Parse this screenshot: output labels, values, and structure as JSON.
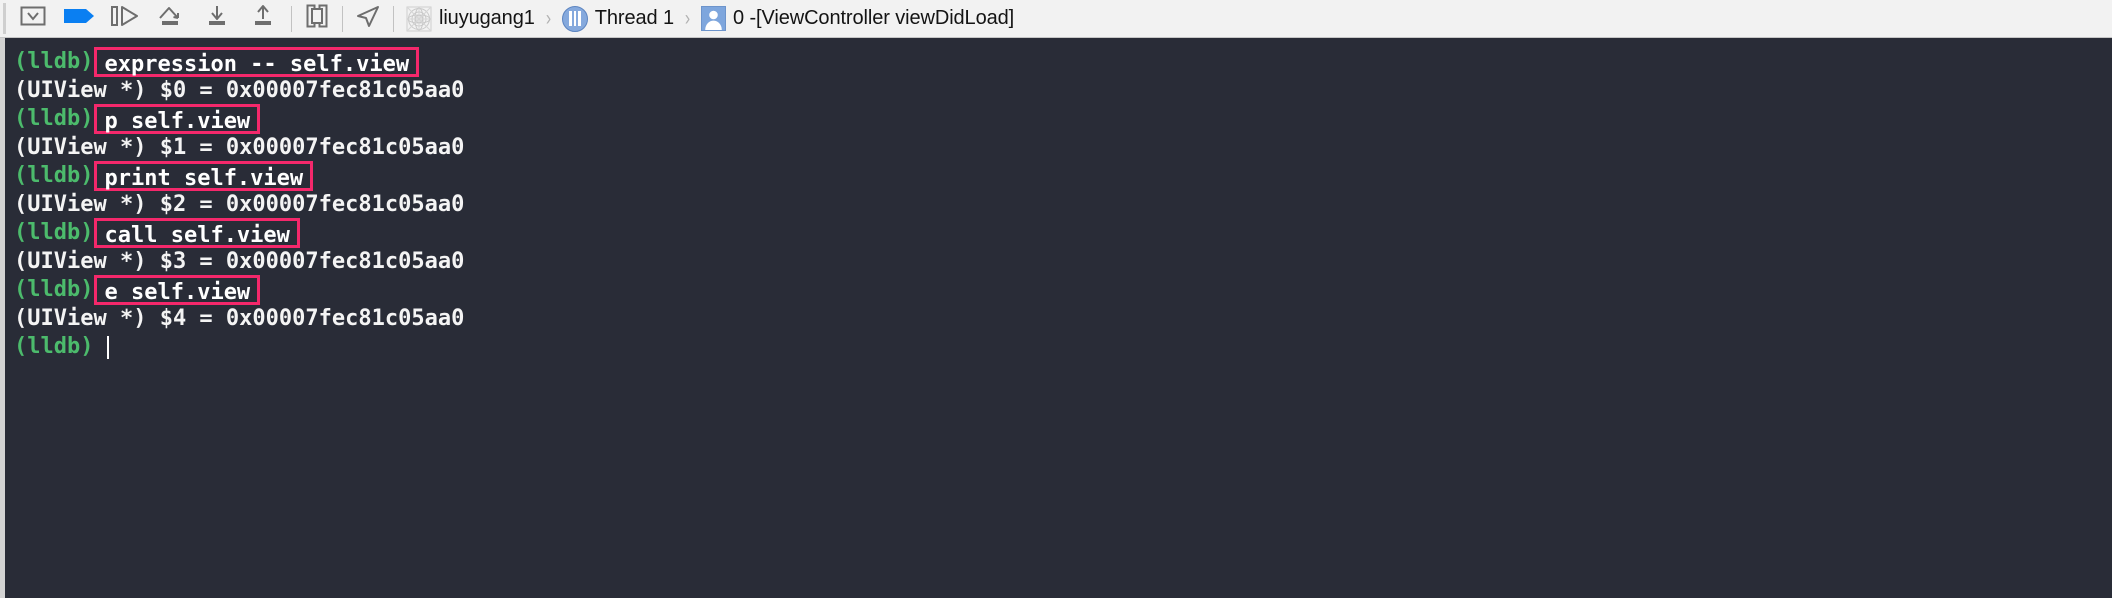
{
  "toolbar": {
    "buttons": [
      {
        "name": "hide-console-button",
        "icon": "panel-chevron-down-icon",
        "label": "Hide Console"
      },
      {
        "name": "deactivate-breakpoints-button",
        "icon": "breakpoint-flag-icon",
        "label": "Deactivate Breakpoints"
      },
      {
        "name": "continue-button",
        "icon": "pause-play-icon",
        "label": "Continue program execution"
      },
      {
        "name": "step-over-button",
        "icon": "step-over-icon",
        "label": "Step over"
      },
      {
        "name": "step-into-button",
        "icon": "step-into-icon",
        "label": "Step into"
      },
      {
        "name": "step-out-button",
        "icon": "step-out-icon",
        "label": "Step out"
      },
      {
        "name": "debug-view-hierarchy-button",
        "icon": "view-hierarchy-icon",
        "label": "Debug View Hierarchy"
      },
      {
        "name": "simulate-location-button",
        "icon": "location-arrow-icon",
        "label": "Simulate Location"
      }
    ]
  },
  "breadcrumb": {
    "process": {
      "label": "liuyugang1",
      "icon": "process-mesh-icon"
    },
    "thread": {
      "label": "Thread 1",
      "icon": "thread-icon"
    },
    "frame": {
      "label": "0 -[ViewController viewDidLoad]",
      "icon": "stack-frame-icon"
    },
    "separator": "›"
  },
  "console": {
    "prompt": "(lldb)",
    "result_address": "0x00007fec81c05aa0",
    "caret_visible": true,
    "lines": [
      {
        "type": "command",
        "prompt": "(lldb)",
        "command": "expression -- self.view",
        "highlighted": true
      },
      {
        "type": "output",
        "text": "(UIView *) $0 = 0x00007fec81c05aa0"
      },
      {
        "type": "command",
        "prompt": "(lldb)",
        "command": "p self.view",
        "highlighted": true
      },
      {
        "type": "output",
        "text": "(UIView *) $1 = 0x00007fec81c05aa0"
      },
      {
        "type": "command",
        "prompt": "(lldb)",
        "command": "print self.view",
        "highlighted": true
      },
      {
        "type": "output",
        "text": "(UIView *) $2 = 0x00007fec81c05aa0"
      },
      {
        "type": "command",
        "prompt": "(lldb)",
        "command": "call self.view",
        "highlighted": true
      },
      {
        "type": "output",
        "text": "(UIView *) $3 = 0x00007fec81c05aa0"
      },
      {
        "type": "command",
        "prompt": "(lldb)",
        "command": "e self.view",
        "highlighted": true
      },
      {
        "type": "output",
        "text": "(UIView *) $4 = 0x00007fec81c05aa0"
      },
      {
        "type": "prompt",
        "prompt": "(lldb)"
      }
    ]
  },
  "colors": {
    "console_background": "#292c37",
    "prompt_green": "#4cbb6c",
    "highlight_pink": "#f4286b",
    "text_white": "#f2f2f2",
    "toolbar_background": "#f2f2f2",
    "accent_blue": "#0a7ff2"
  }
}
